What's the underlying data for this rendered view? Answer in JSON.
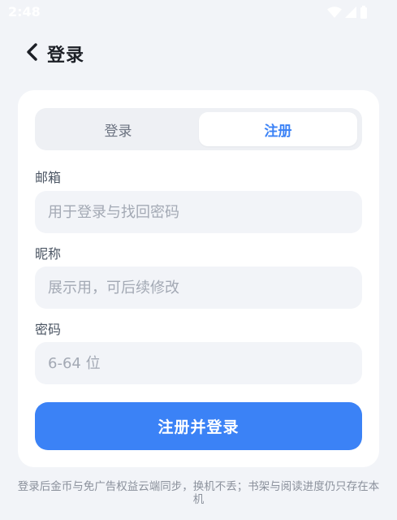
{
  "status_bar": {
    "time": "2:48"
  },
  "header": {
    "title": "登录"
  },
  "tabs": {
    "login": "登录",
    "register": "注册"
  },
  "form": {
    "email": {
      "label": "邮箱",
      "placeholder": "用于登录与找回密码",
      "value": ""
    },
    "nickname": {
      "label": "昵称",
      "placeholder": "展示用，可后续修改",
      "value": ""
    },
    "password": {
      "label": "密码",
      "placeholder": "6-64 位",
      "value": ""
    }
  },
  "submit_label": "注册并登录",
  "footer_note": "登录后金币与免广告权益云端同步，换机不丢；书架与阅读进度仍只存在本机",
  "colors": {
    "accent": "#3b82f6",
    "page_bg": "#f2f4f8",
    "card_bg": "#ffffff"
  },
  "icons": [
    "back-chevron-icon",
    "wifi-icon",
    "signal-icon",
    "battery-icon"
  ]
}
